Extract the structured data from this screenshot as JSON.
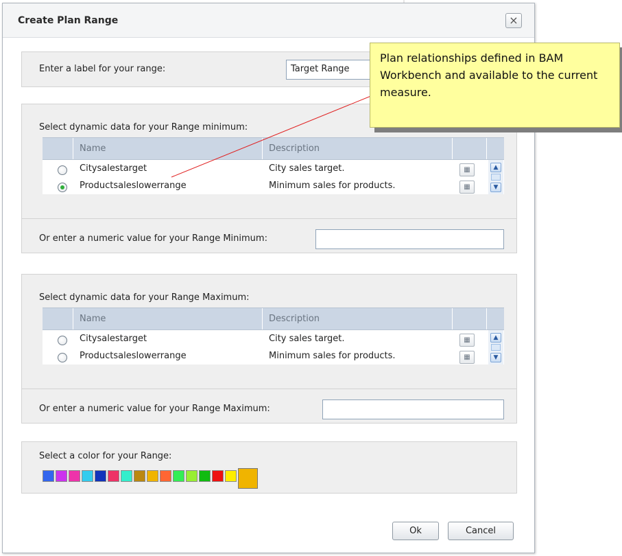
{
  "dialog": {
    "title": "Create Plan Range",
    "close_label": "×"
  },
  "label_section": {
    "prompt": "Enter a label for your range:",
    "value": "Target Range"
  },
  "minimum_section": {
    "prompt": "Select dynamic data for your Range minimum:",
    "columns": [
      "Name",
      "Description"
    ],
    "rows": [
      {
        "name": "Citysalestarget",
        "description": "City sales target.",
        "selected": false
      },
      {
        "name": "Productsaleslowerrange",
        "description": "Minimum sales for products.",
        "selected": true
      }
    ],
    "numeric_prompt": "Or enter a numeric value for your Range Minimum:",
    "numeric_value": ""
  },
  "maximum_section": {
    "prompt": "Select dynamic data for your Range Maximum:",
    "columns": [
      "Name",
      "Description"
    ],
    "rows": [
      {
        "name": "Citysalestarget",
        "description": "City sales target.",
        "selected": false
      },
      {
        "name": "Productsaleslowerrange",
        "description": "Minimum sales for products.",
        "selected": false
      }
    ],
    "numeric_prompt": "Or enter a numeric value for your Range Maximum:",
    "numeric_value": ""
  },
  "color_section": {
    "prompt": "Select a color for your Range:",
    "swatches": [
      "#3366ee",
      "#cc33ee",
      "#ee33aa",
      "#33ccee",
      "#1133bb",
      "#ee3366",
      "#33eecc",
      "#bb8811",
      "#f0b400",
      "#ff6633",
      "#33ee55",
      "#99ee33",
      "#11bb11",
      "#ee1111",
      "#ffee00",
      "#f0b400"
    ],
    "selected_index": 15
  },
  "buttons": {
    "ok": "Ok",
    "cancel": "Cancel"
  },
  "icons": {
    "grid_button": "table-icon",
    "scroll_up": "chevron-up-icon",
    "scroll_down": "chevron-down-icon"
  },
  "callout": {
    "text": "Plan relationships defined in BAM Workbench and available to the current measure."
  }
}
